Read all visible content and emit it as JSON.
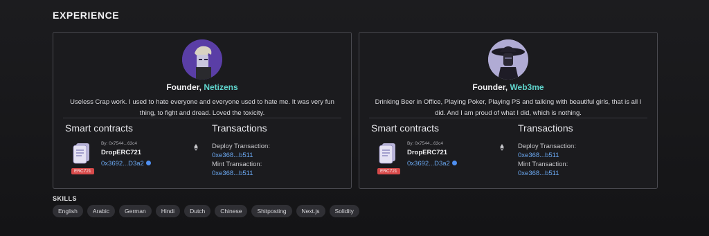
{
  "section": {
    "title": "EXPERIENCE"
  },
  "experiences": [
    {
      "role": "Founder,",
      "company": "Netizens",
      "description": "Useless Crap work. I used to hate everyone and everyone used to hate me. It was very fun thing, to fight and dread. Loved the toxicity.",
      "smart_contracts_title": "Smart contracts",
      "transactions_title": "Transactions",
      "contract": {
        "by": "By: 0x7544...63c4",
        "name": "DropERC721",
        "address": "0x3692...D3a2",
        "badge": "ERC721"
      },
      "deploy_label": "Deploy Transaction:",
      "deploy_value": "0xe368...b511",
      "mint_label": "Mint Transaction:",
      "mint_value": "0xe368...b511"
    },
    {
      "role": "Founder,",
      "company": "Web3me",
      "description": "Drinking Beer in Office, Playing Poker, Playing PS and talking with beautiful girls, that is all I did. And I am proud of what I did, which is nothing.",
      "smart_contracts_title": "Smart contracts",
      "transactions_title": "Transactions",
      "contract": {
        "by": "By: 0x7544...63c4",
        "name": "DropERC721",
        "address": "0x3692...D3a2",
        "badge": "ERC721"
      },
      "deploy_label": "Deploy Transaction:",
      "deploy_value": "0xe368...b511",
      "mint_label": "Mint Transaction:",
      "mint_value": "0xe368...b511"
    }
  ],
  "skills": {
    "title": "SKILLS",
    "items": [
      "English",
      "Arabic",
      "German",
      "Hindi",
      "Dutch",
      "Chinese",
      "Shitposting",
      "Next.js",
      "Solidity"
    ]
  },
  "colors": {
    "accent_company": "#5fd3cb",
    "link": "#6aa7f0",
    "badge": "#d84a4a"
  },
  "icons": [
    "avatar",
    "document-icon",
    "ethereum-icon",
    "verified-icon"
  ]
}
